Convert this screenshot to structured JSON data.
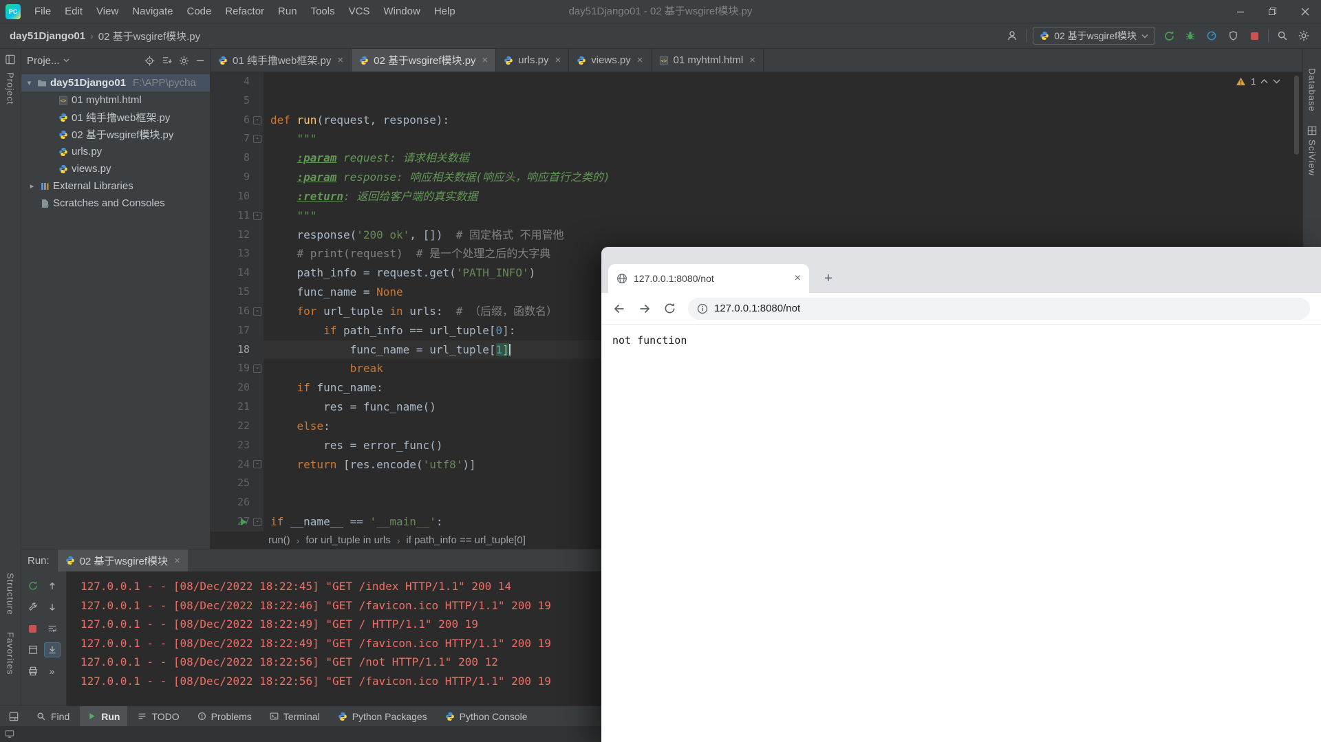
{
  "title_bar": {
    "logo_text": "PC",
    "menus": [
      "File",
      "Edit",
      "View",
      "Navigate",
      "Code",
      "Refactor",
      "Run",
      "Tools",
      "VCS",
      "Window",
      "Help"
    ],
    "title": "day51Django01 - 02 基于wsgiref模块.py"
  },
  "nav_bar": {
    "project": "day51Django01",
    "file": "02 基于wsgiref模块.py",
    "separator": "›",
    "run_config": "02 基于wsgiref模块"
  },
  "tool_stripes": {
    "left": [
      "Project",
      "Structure",
      "Favorites"
    ],
    "right": [
      "Database",
      "SciView"
    ]
  },
  "project_panel": {
    "title": "Proje...",
    "root_name": "day51Django01",
    "root_path": "F:\\APP\\pycha",
    "files": [
      {
        "name": "01 myhtml.html",
        "type": "html"
      },
      {
        "name": "01 纯手撸web框架.py",
        "type": "py"
      },
      {
        "name": "02 基于wsgiref模块.py",
        "type": "py"
      },
      {
        "name": "urls.py",
        "type": "py"
      },
      {
        "name": "views.py",
        "type": "py"
      }
    ],
    "extra": [
      {
        "name": "External Libraries",
        "type": "lib",
        "chevron": "▸"
      },
      {
        "name": "Scratches and Consoles",
        "type": "scratch",
        "chevron": ""
      }
    ]
  },
  "editor": {
    "tabs": [
      {
        "label": "01 纯手撸web框架.py",
        "type": "py",
        "active": false
      },
      {
        "label": "02 基于wsgiref模块.py",
        "type": "py",
        "active": true
      },
      {
        "label": "urls.py",
        "type": "py",
        "active": false
      },
      {
        "label": "views.py",
        "type": "py",
        "active": false
      },
      {
        "label": "01 myhtml.html",
        "type": "html",
        "active": false
      }
    ],
    "warning_count": "1",
    "breadcrumbs": [
      "run()",
      "for url_tuple in urls",
      "if path_info == url_tuple[0]"
    ],
    "lines": [
      {
        "num": "4",
        "seg": []
      },
      {
        "num": "5",
        "seg": []
      },
      {
        "num": "6",
        "fold": true,
        "seg": [
          [
            "k",
            "def "
          ],
          [
            "f",
            "run"
          ],
          [
            "t",
            "(request, response):"
          ]
        ]
      },
      {
        "num": "7",
        "fold": true,
        "seg": [
          [
            "d",
            "    \"\"\""
          ]
        ]
      },
      {
        "num": "8",
        "seg": [
          [
            "d",
            "    "
          ],
          [
            "dt",
            ":param"
          ],
          [
            "d",
            " request: 请求相关数据"
          ]
        ]
      },
      {
        "num": "9",
        "seg": [
          [
            "d",
            "    "
          ],
          [
            "dt",
            ":param"
          ],
          [
            "d",
            " response: 响应相关数据(响应头，响应首行之类的)"
          ]
        ]
      },
      {
        "num": "10",
        "seg": [
          [
            "d",
            "    "
          ],
          [
            "dt",
            ":return"
          ],
          [
            "d",
            ": 返回给客户端的真实数据"
          ]
        ]
      },
      {
        "num": "11",
        "fold": true,
        "seg": [
          [
            "d",
            "    \"\"\""
          ]
        ]
      },
      {
        "num": "12",
        "seg": [
          [
            "t",
            "    response("
          ],
          [
            "s",
            "'200 ok'"
          ],
          [
            "t",
            ", [])  "
          ],
          [
            "c",
            "# 固定格式 不用管他"
          ]
        ]
      },
      {
        "num": "13",
        "seg": [
          [
            "c",
            "    # print(request)  # 是一个处理之后的大字典"
          ]
        ]
      },
      {
        "num": "14",
        "seg": [
          [
            "t",
            "    path_info = request.get("
          ],
          [
            "s",
            "'PATH_INFO'"
          ],
          [
            "t",
            ")"
          ]
        ]
      },
      {
        "num": "15",
        "seg": [
          [
            "t",
            "    func_name = "
          ],
          [
            "k",
            "None"
          ]
        ]
      },
      {
        "num": "16",
        "fold": true,
        "seg": [
          [
            "k",
            "    for"
          ],
          [
            "t",
            " url_tuple "
          ],
          [
            "k",
            "in"
          ],
          [
            "t",
            " urls:  "
          ],
          [
            "c",
            "# （后缀，函数名）"
          ]
        ]
      },
      {
        "num": "17",
        "seg": [
          [
            "k",
            "        if"
          ],
          [
            "t",
            " path_info == url_tuple["
          ],
          [
            "n",
            "0"
          ],
          [
            "t",
            "]:"
          ]
        ]
      },
      {
        "num": "18",
        "current": true,
        "caret": true,
        "seg": [
          [
            "t",
            "            func_name = url_tuple["
          ],
          [
            "n hl",
            "1"
          ],
          [
            "t hl",
            "]"
          ]
        ]
      },
      {
        "num": "19",
        "fold": true,
        "seg": [
          [
            "k",
            "            break"
          ]
        ]
      },
      {
        "num": "20",
        "seg": [
          [
            "k",
            "    if"
          ],
          [
            "t",
            " func_name:"
          ]
        ]
      },
      {
        "num": "21",
        "seg": [
          [
            "t",
            "        res = func_name()"
          ]
        ]
      },
      {
        "num": "22",
        "seg": [
          [
            "k",
            "    else"
          ],
          [
            "t",
            ":"
          ]
        ]
      },
      {
        "num": "23",
        "seg": [
          [
            "t",
            "        res = error_func()"
          ]
        ]
      },
      {
        "num": "24",
        "fold": true,
        "seg": [
          [
            "k",
            "    return"
          ],
          [
            "t",
            " [res.encode("
          ],
          [
            "s",
            "'utf8'"
          ],
          [
            "t",
            ")]"
          ]
        ]
      },
      {
        "num": "25",
        "seg": []
      },
      {
        "num": "26",
        "seg": []
      },
      {
        "num": "27",
        "fold": true,
        "play": true,
        "seg": [
          [
            "k",
            "if"
          ],
          [
            "t",
            " __name__ == "
          ],
          [
            "s",
            "'__main__'"
          ],
          [
            "t",
            ":"
          ]
        ]
      }
    ]
  },
  "run_panel": {
    "label": "Run:",
    "tab": "02 基于wsgiref模块",
    "console": [
      "127.0.0.1 - - [08/Dec/2022 18:22:45] \"GET /index HTTP/1.1\" 200 14",
      "127.0.0.1 - - [08/Dec/2022 18:22:46] \"GET /favicon.ico HTTP/1.1\" 200 19",
      "127.0.0.1 - - [08/Dec/2022 18:22:49] \"GET / HTTP/1.1\" 200 19",
      "127.0.0.1 - - [08/Dec/2022 18:22:49] \"GET /favicon.ico HTTP/1.1\" 200 19",
      "127.0.0.1 - - [08/Dec/2022 18:22:56] \"GET /not HTTP/1.1\" 200 12",
      "127.0.0.1 - - [08/Dec/2022 18:22:56] \"GET /favicon.ico HTTP/1.1\" 200 19"
    ]
  },
  "bottom_bar": {
    "items": [
      {
        "label": "Find",
        "icon": "search",
        "active": false
      },
      {
        "label": "Run",
        "icon": "run",
        "active": true
      },
      {
        "label": "TODO",
        "icon": "todo",
        "active": false
      },
      {
        "label": "Problems",
        "icon": "problems",
        "active": false
      },
      {
        "label": "Terminal",
        "icon": "terminal",
        "active": false
      },
      {
        "label": "Python Packages",
        "icon": "py",
        "active": false
      },
      {
        "label": "Python Console",
        "icon": "py",
        "active": false
      }
    ]
  },
  "browser": {
    "tab_title": "127.0.0.1:8080/not",
    "url": "127.0.0.1:8080/not",
    "content": "not function",
    "new_tab": "+",
    "close": "×"
  },
  "colors": {
    "panel": "#3c3f41",
    "editor_bg": "#2b2b2b",
    "keyword": "#cc7832",
    "string": "#6a8759",
    "comment": "#808080",
    "stderr": "#ef6e65",
    "accent_green": "#499c54",
    "stop_red": "#c75450"
  }
}
